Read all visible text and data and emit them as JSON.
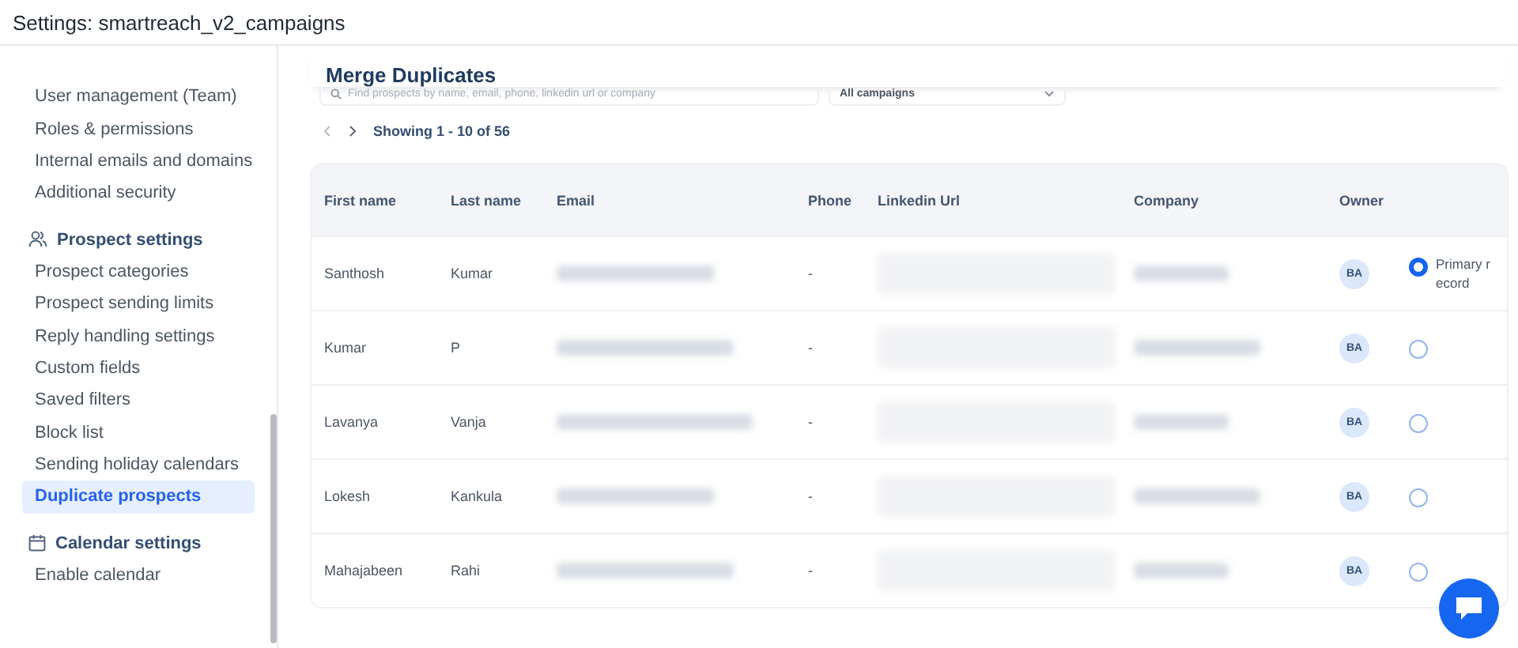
{
  "window": {
    "title": "Settings: smartreach_v2_campaigns"
  },
  "sidebar": {
    "items": [
      {
        "label": "User management (Team)",
        "kind": "link",
        "selected": false
      },
      {
        "label": "Roles & permissions",
        "kind": "link",
        "selected": false
      },
      {
        "label": "Internal emails and domains",
        "kind": "link",
        "selected": false
      },
      {
        "label": "Additional security",
        "kind": "link",
        "selected": false
      },
      {
        "label": "Prospect settings",
        "kind": "section"
      },
      {
        "label": "Prospect categories",
        "kind": "link",
        "selected": false
      },
      {
        "label": "Prospect sending limits",
        "kind": "link",
        "selected": false
      },
      {
        "label": "Reply handling settings",
        "kind": "link",
        "selected": false
      },
      {
        "label": "Custom fields",
        "kind": "link",
        "selected": false
      },
      {
        "label": "Saved filters",
        "kind": "link",
        "selected": false
      },
      {
        "label": "Block list",
        "kind": "link",
        "selected": false
      },
      {
        "label": "Sending holiday calendars",
        "kind": "link",
        "selected": false
      },
      {
        "label": "Duplicate prospects",
        "kind": "link",
        "selected": true
      },
      {
        "label": "Calendar settings",
        "kind": "section"
      },
      {
        "label": "Enable calendar",
        "kind": "link",
        "selected": false
      }
    ]
  },
  "main": {
    "title": "Merge Duplicates",
    "search": {
      "placeholder": "Find prospects by name, email, phone, linkedin url or company"
    },
    "campaign_filter": {
      "value": "All campaigns"
    },
    "pagination": {
      "text": "Showing 1 - 10 of 56"
    },
    "table": {
      "columns": [
        "First name",
        "Last name",
        "Email",
        "Phone",
        "Linkedin Url",
        "Company",
        "Owner"
      ],
      "rows": [
        {
          "first_name": "Santhosh",
          "last_name": "Kumar",
          "phone": "-",
          "owner": "BA",
          "selected": true,
          "radio_label": "Primary record"
        },
        {
          "first_name": "Kumar",
          "last_name": "P",
          "phone": "-",
          "owner": "BA",
          "selected": false
        },
        {
          "first_name": "Lavanya",
          "last_name": "Vanja",
          "phone": "-",
          "owner": "BA",
          "selected": false
        },
        {
          "first_name": "Lokesh",
          "last_name": "Kankula",
          "phone": "-",
          "owner": "BA",
          "selected": false
        },
        {
          "first_name": "Mahajabeen",
          "last_name": "Rahi",
          "phone": "-",
          "owner": "BA",
          "selected": false
        }
      ]
    }
  }
}
